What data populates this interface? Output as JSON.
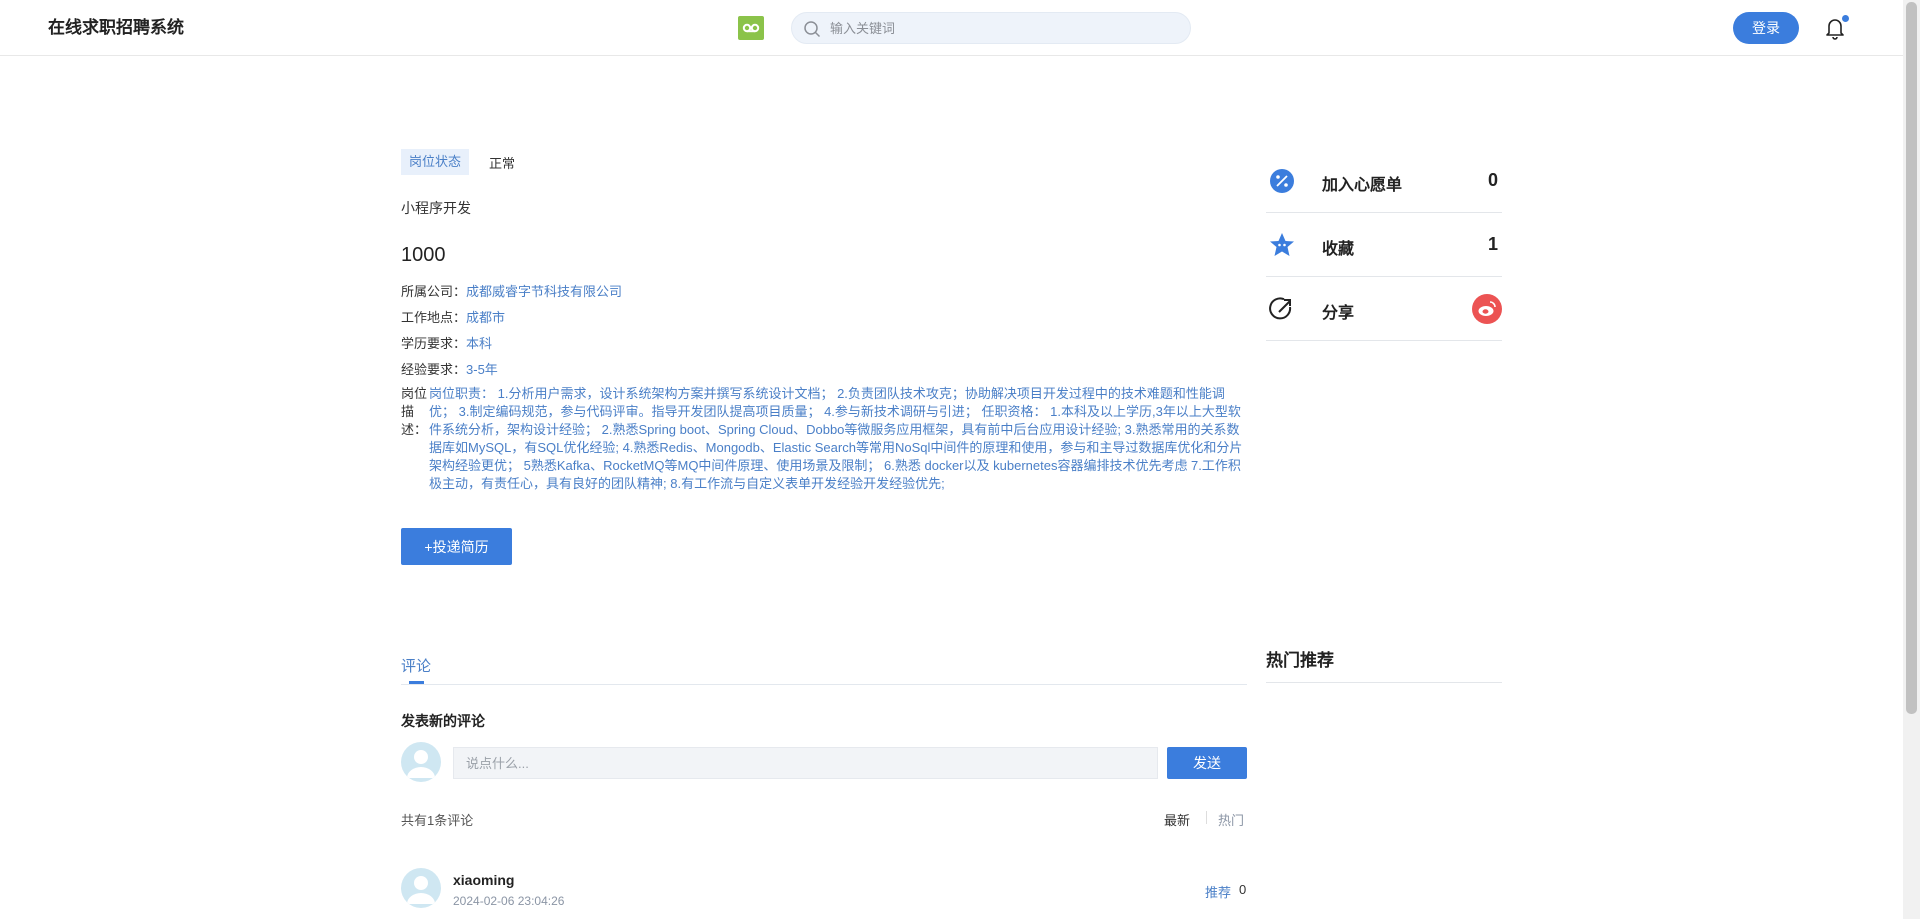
{
  "header": {
    "site_title": "在线求职招聘系统",
    "search_placeholder": "输入关键词",
    "login_label": "登录",
    "logo_icon": "voicemail-icon",
    "search_icon": "search-icon",
    "bell_icon": "bell-icon",
    "accent": "#3b7ddd"
  },
  "job": {
    "status_label": "岗位状态",
    "status_value": "正常",
    "title": "小程序开发",
    "salary": "1000",
    "company_label": "所属公司：",
    "company": "成都威睿字节科技有限公司",
    "location_label": "工作地点：",
    "location": "成都市",
    "education_label": "学历要求：",
    "education": "本科",
    "experience_label": "经验要求：",
    "experience": "3-5年",
    "description_label": "岗位描述：",
    "description": "岗位职责： 1.分析用户需求，设计系统架构方案并撰写系统设计文档； 2.负责团队技术攻克；协助解决项目开发过程中的技术难题和性能调优； 3.制定编码规范，参与代码评审。指导开发团队提高项目质量； 4.参与新技术调研与引进； 任职资格： 1.本科及以上学历,3年以上大型软件系统分析，架构设计经验； 2.熟悉Spring boot、Spring Cloud、Dobbo等微服务应用框架，具有前中后台应用设计经验; 3.熟悉常用的关系数据库如MySQL，有SQL优化经验; 4.熟悉Redis、Mongodb、Elastic Search等常用NoSql中间件的原理和使用，参与和主导过数据库优化和分片架构经验更优； 5熟悉Kafka、RocketMQ等MQ中间件原理、使用场景及限制； 6.熟悉 docker以及 kubernetes容器编排技术优先考虑 7.工作积极主动，有责任心，具有良好的团队精神; 8.有工作流与自定义表单开发经验开发经验优先;",
    "apply_label": "+投递简历"
  },
  "comments": {
    "tab_label": "评论",
    "new_title": "发表新的评论",
    "input_placeholder": "说点什么...",
    "send_label": "发送",
    "count_text": "共有1条评论",
    "sort_latest": "最新",
    "sort_hot": "热门",
    "items": [
      {
        "user": "xiaoming",
        "time": "2024-02-06 23:04:26",
        "recommend_label": "推荐",
        "recommend_count": "0"
      }
    ]
  },
  "sidebar": {
    "wishlist_label": "加入心愿单",
    "wishlist_count": "0",
    "wishlist_icon": "discount-badge-icon",
    "favorite_label": "收藏",
    "favorite_count": "1",
    "favorite_icon": "star-badge-icon",
    "share_label": "分享",
    "share_icon": "share-arrow-icon",
    "weibo_icon": "weibo-icon",
    "hot_title": "热门推荐"
  }
}
